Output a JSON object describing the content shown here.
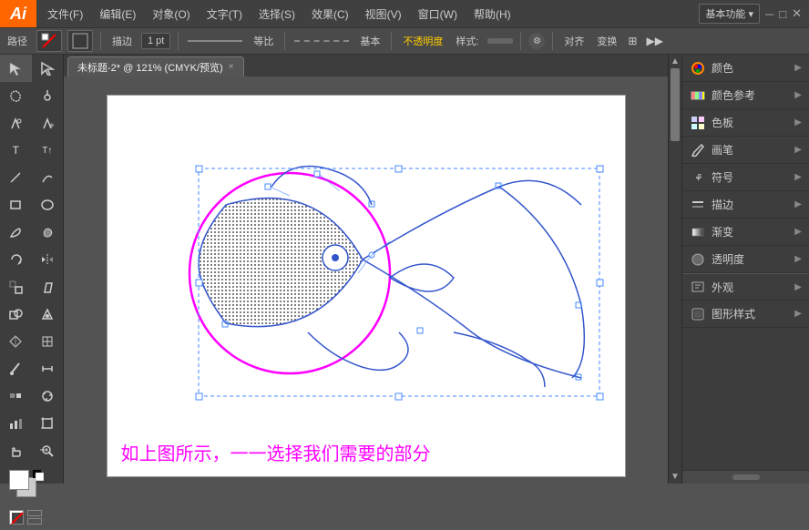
{
  "app": {
    "logo": "Ai",
    "title": "未标题-2* @ 121% (CMYK/预览)"
  },
  "menu": {
    "items": [
      "文件(F)",
      "编辑(E)",
      "对象(O)",
      "文字(T)",
      "选择(S)",
      "效果(C)",
      "视图(V)",
      "窗口(W)",
      "帮助(H)"
    ]
  },
  "toolbar": {
    "label": "路径",
    "stroke_label": "描边",
    "stroke_value": "1 pt",
    "line1_label": "等比",
    "line2_label": "基本",
    "opacity_label": "不透明度",
    "style_label": "样式:",
    "align_label": "对齐",
    "transform_label": "变换"
  },
  "tab": {
    "title": "未标题-2* @ 121% (CMYK/预览)",
    "close": "×"
  },
  "canvas": {
    "caption": "如上图所示，一一选择我们需要的部分"
  },
  "right_panel": {
    "items": [
      {
        "id": "color",
        "label": "颜色",
        "icon": "color-wheel"
      },
      {
        "id": "color-ref",
        "label": "颜色参考",
        "icon": "color-ref"
      },
      {
        "id": "swatches",
        "label": "色板",
        "icon": "swatches"
      },
      {
        "id": "brush",
        "label": "画笔",
        "icon": "brush"
      },
      {
        "id": "symbol",
        "label": "符号",
        "icon": "symbol"
      },
      {
        "id": "stroke",
        "label": "描边",
        "icon": "stroke"
      },
      {
        "id": "gradient",
        "label": "渐变",
        "icon": "gradient"
      },
      {
        "id": "opacity",
        "label": "透明度",
        "icon": "opacity"
      },
      {
        "id": "appear",
        "label": "外观",
        "icon": "appear"
      },
      {
        "id": "graphstyle",
        "label": "图形样式",
        "icon": "graphstyle"
      }
    ]
  },
  "tools": [
    [
      "arrow",
      "direct-select"
    ],
    [
      "lasso",
      "magic-wand"
    ],
    [
      "pen",
      "add-anchor"
    ],
    [
      "type",
      "touch-type"
    ],
    [
      "line",
      "arc"
    ],
    [
      "rect",
      "roundrect"
    ],
    [
      "brush",
      "blob-brush"
    ],
    [
      "rotate",
      "reflect"
    ],
    [
      "scale",
      "shear"
    ],
    [
      "shape-builder",
      "live-paint"
    ],
    [
      "perspective-grid",
      "perspective-select"
    ],
    [
      "mesh",
      "gradient-tool"
    ],
    [
      "eyedropper",
      "measure"
    ],
    [
      "blend",
      "symbol-spray"
    ],
    [
      "bar-graph",
      "column-graph"
    ],
    [
      "artboard",
      "slice"
    ],
    [
      "hand",
      "zoom"
    ],
    [
      "swatches-tool",
      ""
    ]
  ]
}
